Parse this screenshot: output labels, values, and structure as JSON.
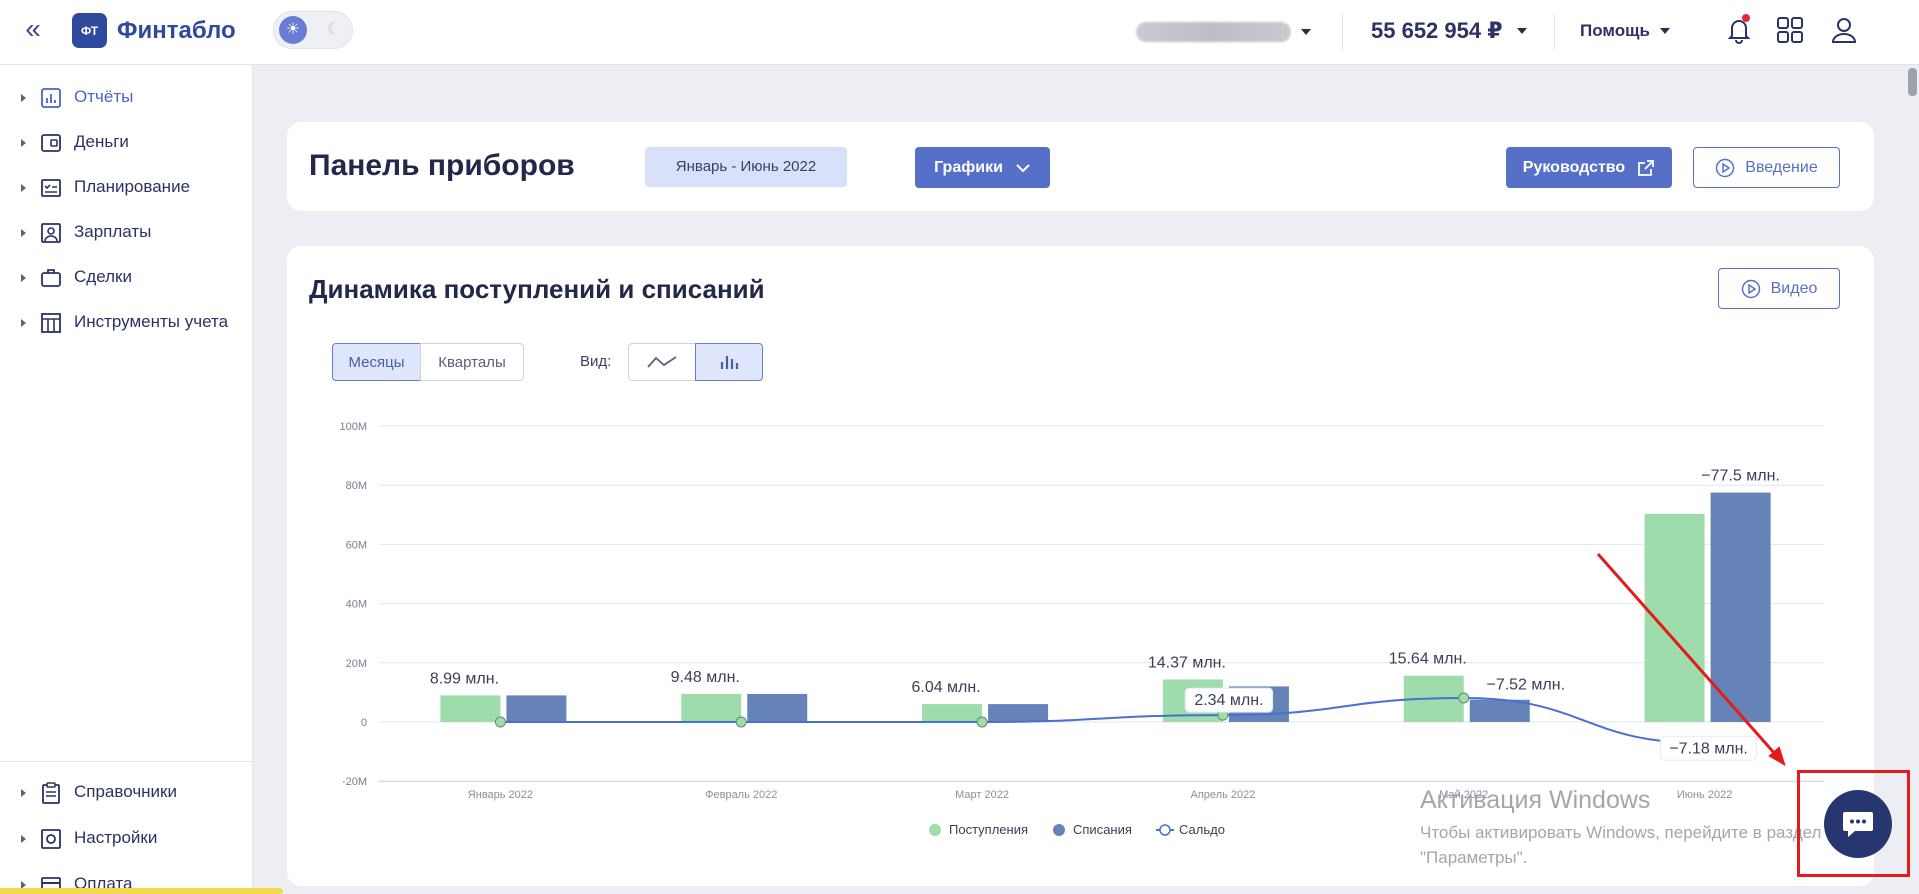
{
  "app": {
    "logo_short": "ФТ",
    "logo_name": "Финтабло"
  },
  "topbar": {
    "balance": "55 652 954 ₽",
    "help_label": "Помощь"
  },
  "sidebar": {
    "items": [
      {
        "label": "Отчёты",
        "icon": "reports-icon",
        "active": true
      },
      {
        "label": "Деньги",
        "icon": "wallet-icon"
      },
      {
        "label": "Планирование",
        "icon": "planning-icon"
      },
      {
        "label": "Зарплаты",
        "icon": "salary-icon"
      },
      {
        "label": "Сделки",
        "icon": "briefcase-icon"
      },
      {
        "label": "Инструменты учета",
        "icon": "table-icon"
      }
    ],
    "bottom_items": [
      {
        "label": "Справочники",
        "icon": "clipboard-icon"
      },
      {
        "label": "Настройки",
        "icon": "settings-icon"
      },
      {
        "label": "Оплата",
        "icon": "card-icon"
      }
    ]
  },
  "header": {
    "title": "Панель приборов",
    "period": "Январь - Июнь 2022",
    "graphs_label": "Графики",
    "guide_label": "Руководство",
    "intro_label": "Введение"
  },
  "chart_section": {
    "title": "Динамика поступлений и списаний",
    "video_label": "Видео",
    "period_tabs": [
      "Месяцы",
      "Кварталы"
    ],
    "view_label": "Вид:"
  },
  "chart_data": {
    "type": "bar",
    "categories": [
      "Январь 2022",
      "Февраль 2022",
      "Март 2022",
      "Апрель 2022",
      "Май 2022",
      "Июнь 2022"
    ],
    "series": [
      {
        "name": "Поступления",
        "type": "bar",
        "color": "#9fdcab",
        "values": [
          8.99,
          9.48,
          6.04,
          14.37,
          15.64,
          70.3
        ]
      },
      {
        "name": "Списания",
        "type": "bar",
        "color": "#6683b8",
        "values": [
          8.99,
          9.48,
          6.04,
          12.03,
          7.52,
          77.5
        ]
      },
      {
        "name": "Сальдо",
        "type": "line",
        "color": "#4a6fd4",
        "values": [
          0,
          0,
          0,
          2.34,
          8.12,
          -7.18
        ]
      }
    ],
    "data_labels": [
      "8.99 млн.",
      "9.48 млн.",
      "6.04 млн.",
      "14.37 млн.",
      "15.64 млн.",
      "−77.5 млн.",
      "2.34 млн.",
      "−7.52 млн.",
      "−7.18 млн."
    ],
    "y_ticks": [
      "100M",
      "80M",
      "60M",
      "40M",
      "20M",
      "0",
      "-20M"
    ],
    "ylim": [
      -20,
      100
    ],
    "grid": true,
    "legend_position": "bottom"
  },
  "watermark": {
    "title": "Активация Windows",
    "line1": "Чтобы активировать Windows, перейдите в раздел",
    "line2": "\"Параметры\"."
  },
  "colors": {
    "accent": "#5670c8",
    "highlight": "#e31b1b",
    "chat": "#27366f"
  }
}
